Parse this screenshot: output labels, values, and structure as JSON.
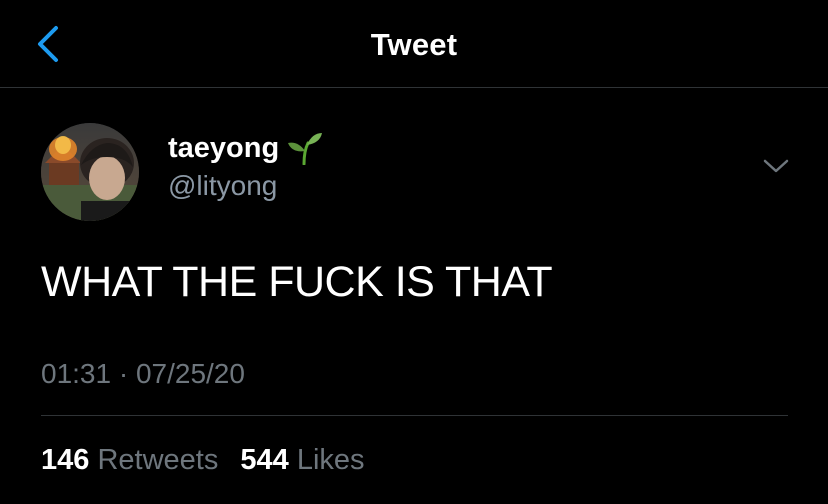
{
  "header": {
    "title": "Tweet",
    "back_icon": "chevron-left-icon",
    "accent_color": "#1d9bf0"
  },
  "tweet": {
    "author": {
      "display_name": "taeyong",
      "name_emoji": "seedling-icon",
      "handle": "@lityong",
      "avatar": "profile-photo"
    },
    "text": "WHAT THE FUCK IS THAT",
    "timestamp": "01:31 · 07/25/20",
    "menu_icon": "chevron-down-icon",
    "stats": {
      "retweets_count": "146",
      "retweets_label": "Retweets",
      "likes_count": "544",
      "likes_label": "Likes"
    }
  },
  "colors": {
    "background": "#000000",
    "primary_text": "#ffffff",
    "secondary_text": "#6e767d",
    "divider": "#2f3336"
  }
}
